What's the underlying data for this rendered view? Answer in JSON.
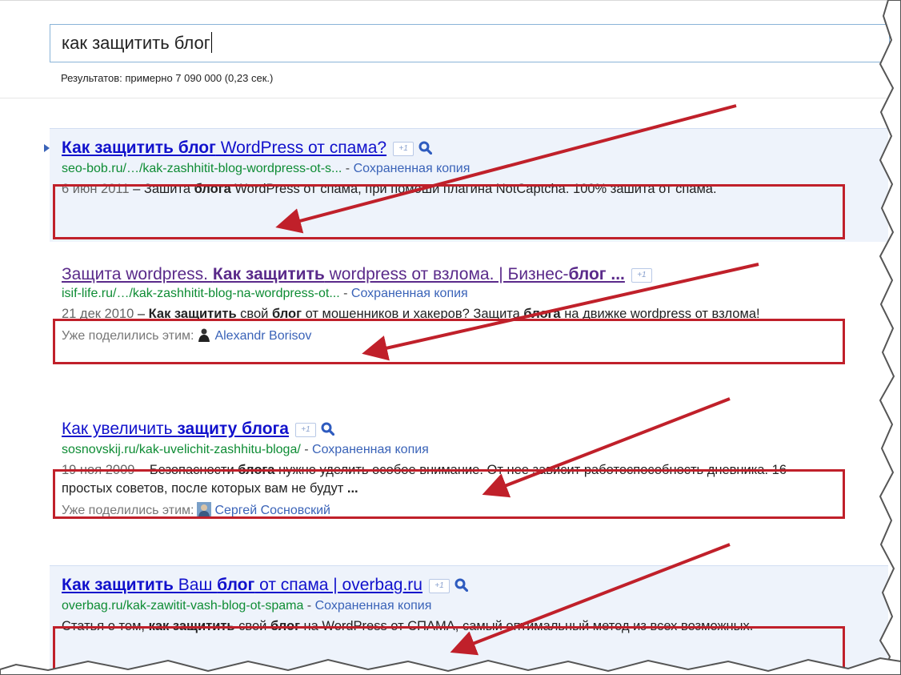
{
  "search": {
    "query": "как защитить блог",
    "stats": "Результатов: примерно 7 090 000 (0,23 сек.)"
  },
  "plus_one_label": "+1",
  "results": [
    {
      "title_parts": [
        "Как защитить блог",
        " WordPress от спама?"
      ],
      "url": "seo-bob.ru/…/kak-zashhitit-blog-wordpress-ot-s...",
      "separator": " - ",
      "cache": "Сохраненная копия",
      "snippet_date": "6 июн 2011",
      "snippet_dash": " – ",
      "snippet_parts": [
        "Зашита ",
        "блога",
        " WordPress от спама, при помоши плагина NotCaptcha. 100% зашита от спама."
      ]
    },
    {
      "title_parts": [
        "Защита wordpress. ",
        "Как защитить",
        " wordpress от взлома. | Бизнес-",
        "блог ..."
      ],
      "url": "isif-life.ru/…/kak-zashhitit-blog-na-wordpress-ot...",
      "separator": " - ",
      "cache": "Сохраненная копия",
      "snippet_date": "21 дек 2010",
      "snippet_dash": " – ",
      "snippet_parts": [
        "Как защитить",
        " свой ",
        "блог",
        " от мошенников и хакеров? Защита ",
        "блога",
        " на движке wordpress от взлома!"
      ],
      "shared_label": "Уже поделились этим:",
      "shared_person": "Alexandr Borisov"
    },
    {
      "title_parts": [
        "Как увеличить ",
        "защиту блога"
      ],
      "url": "sosnovskij.ru/kak-uvelichit-zashhitu-bloga/",
      "separator": " - ",
      "cache": "Сохраненная копия",
      "snippet_date": "19 ноя 2009",
      "snippet_dash": " – ",
      "snippet_parts": [
        "Безопасности ",
        "блога",
        " нужно уделить особое внимание. От нее зависит работоспособность дневника. 16 простых советов, после которых вам не будут ",
        "..."
      ],
      "shared_label": "Уже поделились этим:",
      "shared_person": "Сергей Сосновский"
    },
    {
      "title_parts": [
        "Как защитить",
        " Ваш ",
        "блог",
        " от спама | overbag.ru"
      ],
      "url": "overbag.ru/kak-zawitit-vash-blog-ot-spama",
      "separator": " - ",
      "cache": "Сохраненная копия",
      "snippet_parts": [
        "Статья о том, ",
        "как защитить",
        " свой ",
        "блог",
        " на WordPress от СПАМА, самый оптимальный метод из всех возможных."
      ]
    }
  ],
  "colors": {
    "link": "#1111cc",
    "visited_link": "#5a2a8a",
    "url_green": "#0e8c34",
    "cache_link": "#3a63b8",
    "annotation_red": "#c0202a",
    "highlight_bg": "#eef3fb"
  },
  "icons": [
    "magnifier-icon",
    "plus-one-icon",
    "avatar-icon",
    "result-marker-icon",
    "annotation-arrow-icon"
  ]
}
